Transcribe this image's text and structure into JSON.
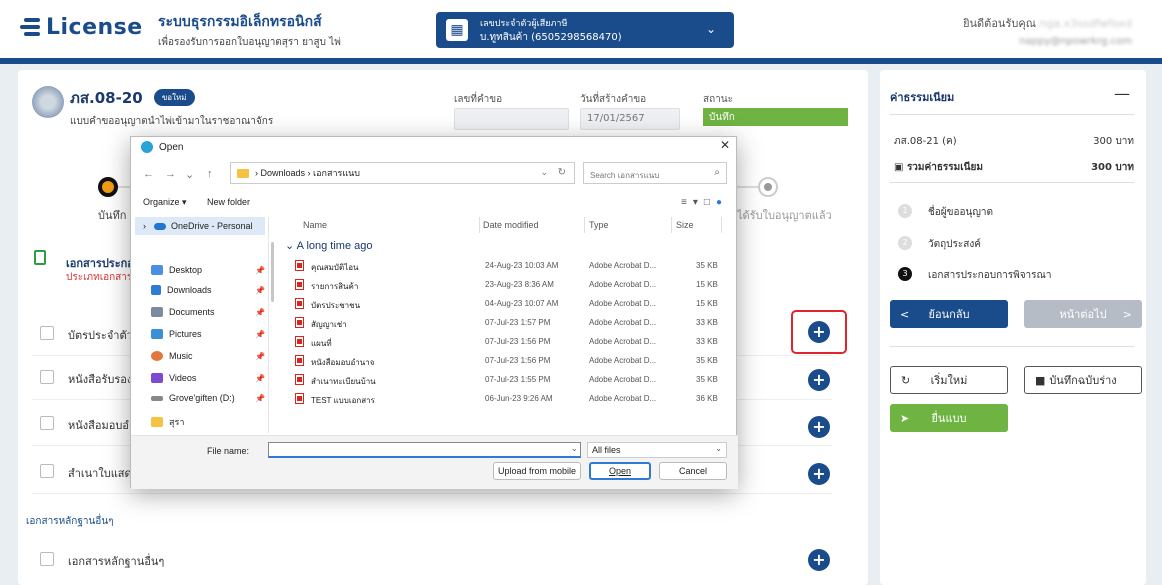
{
  "header": {
    "logo_text": "License",
    "system_title": "ระบบธุรกรรมอิเล็กทรอนิกส์",
    "system_subtitle": "เพื่อรองรับการออกใบอนุญาตสุรา ยาสูบ ไพ่",
    "tax_label": "เลขประจำตัวผู้เสียภาษี",
    "tax_value": "บ.ทูทสินค้า (6505298568470)",
    "welcome_label": "ยินดีต้อนรับคุณ",
    "welcome_name": "nga.x3ssdfwfoxd",
    "welcome_email": "nappy@npowrkrg.com"
  },
  "form": {
    "code": "ภส.08-20",
    "badge": "ขอใหม่",
    "description": "แบบคำขออนุญาตนำไพ่เข้ามาในราชอาณาจักร",
    "req_no_label": "เลขที่คำขอ",
    "req_no_value": "",
    "created_label": "วันที่สร้างคำขอ",
    "created_value": "17/01/2567",
    "status_label": "สถานะ",
    "status_value": "บันทึก",
    "step1_label": "บันทึก",
    "step_last_label": "ได้รับใบอนุญาตแล้ว",
    "section_title": "เอกสารประกอบการพิจารณา",
    "section_sub": "ประเภทเอกสาร",
    "docs": [
      {
        "label": "บัตรประจำตัว"
      },
      {
        "label": "หนังสือรับรอง"
      },
      {
        "label": "หนังสือมอบอำนาจ"
      },
      {
        "label": "สำเนาใบแสดง"
      }
    ],
    "other_header": "เอกสารหลักฐานอื่นๆ",
    "other_doc": "เอกสารหลักฐานอื่นๆ",
    "plus_glyph": "+"
  },
  "fees": {
    "title": "ค่าธรรมเนียม",
    "collapse": "—",
    "row_label": "ภส.08-21 (ค)",
    "row_value": "300 บาท",
    "total_label": "รวมค่าธรรมเนียม",
    "total_value": "300 บาท"
  },
  "steps": [
    {
      "num": "1",
      "label": "ชื่อผู้ขออนุญาต"
    },
    {
      "num": "2",
      "label": "วัตถุประสงค์"
    },
    {
      "num": "3",
      "label": "เอกสารประกอบการพิจารณา"
    }
  ],
  "buttons": {
    "back": "ย้อนกลับ",
    "next": "หน้าต่อไป",
    "reset": "เริ่มใหม่",
    "draft": "บันทึกฉบับร่าง",
    "submit": "ยื่นแบบ"
  },
  "dialog": {
    "title": "Open",
    "path_downloads": "Downloads",
    "path_folder": "เอกสารแนบ",
    "search_placeholder": "Search เอกสารแนบ",
    "organize": "Organize ▾",
    "new_folder": "New folder",
    "onedrive": "OneDrive - Personal",
    "nav": [
      {
        "label": "Desktop",
        "color": "#4a90e2"
      },
      {
        "label": "Downloads",
        "color": "#2f7ad6"
      },
      {
        "label": "Documents",
        "color": "#7a8ba0"
      },
      {
        "label": "Pictures",
        "color": "#3b8fd9"
      },
      {
        "label": "Music",
        "color": "#e2773b"
      },
      {
        "label": "Videos",
        "color": "#7d4bd1"
      },
      {
        "label": "Grove'giften (D:)",
        "color": "#888888"
      },
      {
        "label": "สุรา",
        "color": "#f5c242"
      }
    ],
    "col_name": "Name",
    "col_date": "Date modified",
    "col_type": "Type",
    "col_size": "Size",
    "group": "A long time ago",
    "files": [
      {
        "name": "คุณสมบัติไอน",
        "date": "24-Aug-23 10:03 AM",
        "type": "Adobe Acrobat D...",
        "size": "35 KB"
      },
      {
        "name": "รายการสินค้า",
        "date": "23-Aug-23 8:36 AM",
        "type": "Adobe Acrobat D...",
        "size": "15 KB"
      },
      {
        "name": "บัตรประชาชน",
        "date": "04-Aug-23 10:07 AM",
        "type": "Adobe Acrobat D...",
        "size": "15 KB"
      },
      {
        "name": "สัญญาเช่า",
        "date": "07-Jul-23 1:57 PM",
        "type": "Adobe Acrobat D...",
        "size": "33 KB"
      },
      {
        "name": "แผนที่",
        "date": "07-Jul-23 1:56 PM",
        "type": "Adobe Acrobat D...",
        "size": "33 KB"
      },
      {
        "name": "หนังสือมอบอำนาจ",
        "date": "07-Jul-23 1:56 PM",
        "type": "Adobe Acrobat D...",
        "size": "35 KB"
      },
      {
        "name": "สำเนาทะเบียนบ้าน",
        "date": "07-Jul-23 1:55 PM",
        "type": "Adobe Acrobat D...",
        "size": "35 KB"
      },
      {
        "name": "TEST แบบเอกสาร",
        "date": "06-Jun-23 9:26 AM",
        "type": "Adobe Acrobat D...",
        "size": "36 KB"
      }
    ],
    "filename_label": "File name:",
    "filename_value": "",
    "filetype": "All files",
    "upload_btn": "Upload from mobile",
    "open_btn": "Open",
    "cancel_btn": "Cancel"
  }
}
